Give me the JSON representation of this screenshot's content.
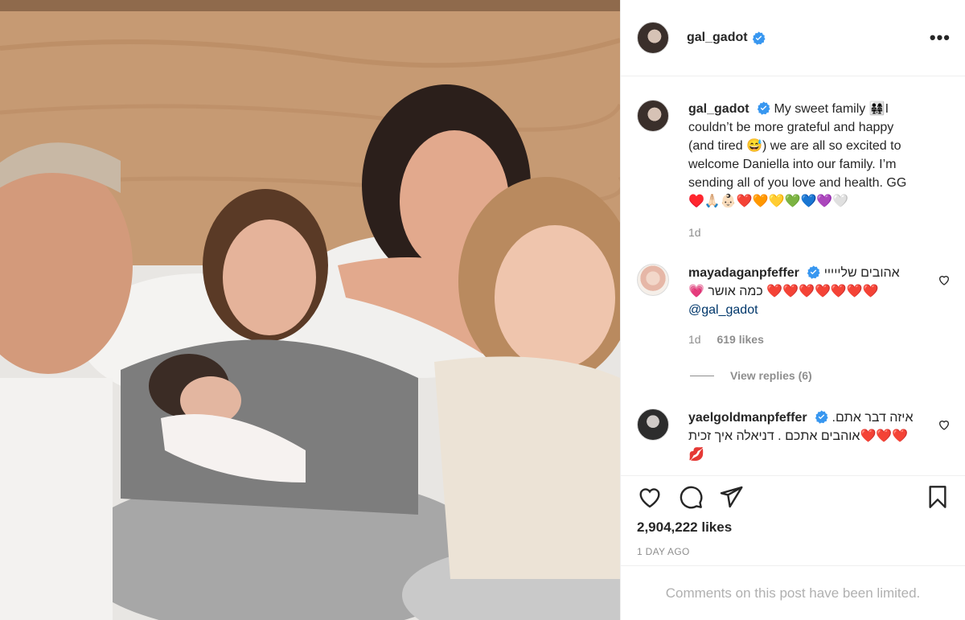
{
  "post": {
    "username": "gal_gadot",
    "caption_text": "My sweet family 👨‍👩‍👧‍👧I couldn’t be more grateful and happy (and tired 😅) we are all so excited to welcome Daniella into our family. I’m sending all of you love and health. GG ♥️🙏🏻👶🏻❤️🧡💛💚💙💜🤍",
    "caption_age": "1d",
    "likes_count": "2,904,222 likes",
    "posted_ago": "1 DAY AGO",
    "limited_notice": "Comments on this post have been limited.",
    "more_label": "•••"
  },
  "comments": [
    {
      "username": "mayadaganpfeffer",
      "text": "אהובים שלייייי❤️❤️❤️❤️❤️❤️❤️ כמה אושר 💗",
      "mention": "@gal_gadot",
      "age": "1d",
      "likes": "619 likes",
      "view_replies": "View replies (6)"
    },
    {
      "username": "yaelgoldmanpfeffer",
      "text": "איזה דבר אתם. ❤️❤️❤️אוהבים אתכם . דניאלה איך זכית 💋"
    }
  ],
  "colors": {
    "verified": "#3897f0",
    "text": "#262626",
    "muted": "#8e8e8e",
    "divider": "#efefef"
  },
  "icons": [
    "verified-badge-icon",
    "more-options-icon",
    "like-heart-icon",
    "comment-icon",
    "share-icon",
    "save-bookmark-icon",
    "comment-like-icon"
  ]
}
